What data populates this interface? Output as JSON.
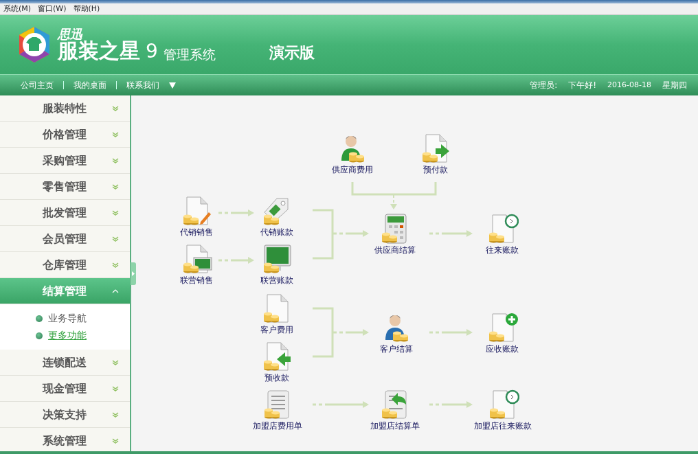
{
  "menu_bar": [
    "系统(M)",
    "窗口(W)",
    "帮助(H)"
  ],
  "header": {
    "brand_small": "思迅",
    "brand": "服装之星",
    "version": "9",
    "product": "管理系统",
    "edition": "演示版"
  },
  "nav": {
    "links": [
      "公司主页",
      "我的桌面",
      "联系我们"
    ],
    "user": "管理员:",
    "greeting": "下午好!",
    "date": "2016-08-18",
    "weekday": "星期四"
  },
  "sidebar": {
    "items": [
      {
        "label": "服装特性",
        "expanded": false
      },
      {
        "label": "价格管理",
        "expanded": false
      },
      {
        "label": "采购管理",
        "expanded": false
      },
      {
        "label": "零售管理",
        "expanded": false
      },
      {
        "label": "批发管理",
        "expanded": false
      },
      {
        "label": "会员管理",
        "expanded": false
      },
      {
        "label": "仓库管理",
        "expanded": false
      },
      {
        "label": "结算管理",
        "expanded": true,
        "children": [
          {
            "label": "业务导航",
            "selected": false
          },
          {
            "label": "更多功能",
            "selected": true
          }
        ]
      },
      {
        "label": "连锁配送",
        "expanded": false
      },
      {
        "label": "现金管理",
        "expanded": false
      },
      {
        "label": "决策支持",
        "expanded": false
      },
      {
        "label": "系统管理",
        "expanded": false
      }
    ]
  },
  "flow": {
    "nodes": [
      {
        "label": "供应商费用",
        "kind": "supplier"
      },
      {
        "label": "预付款",
        "kind": "doc-arrow-right"
      },
      {
        "label": "代销销售",
        "kind": "doc-pencil"
      },
      {
        "label": "代销账款",
        "kind": "tag"
      },
      {
        "label": "供应商结算",
        "kind": "calculator"
      },
      {
        "label": "往来账款",
        "kind": "doc-clock"
      },
      {
        "label": "联营销售",
        "kind": "doc-monitor"
      },
      {
        "label": "联营账款",
        "kind": "monitor"
      },
      {
        "label": "客户费用",
        "kind": "doc"
      },
      {
        "label": "客户结算",
        "kind": "customer"
      },
      {
        "label": "应收账款",
        "kind": "doc-plus"
      },
      {
        "label": "预收款",
        "kind": "doc-arrow-left"
      },
      {
        "label": "加盟店费用单",
        "kind": "doc-lines"
      },
      {
        "label": "加盟店结算单",
        "kind": "doc-return"
      },
      {
        "label": "加盟店往来账款",
        "kind": "doc-clock"
      }
    ]
  }
}
